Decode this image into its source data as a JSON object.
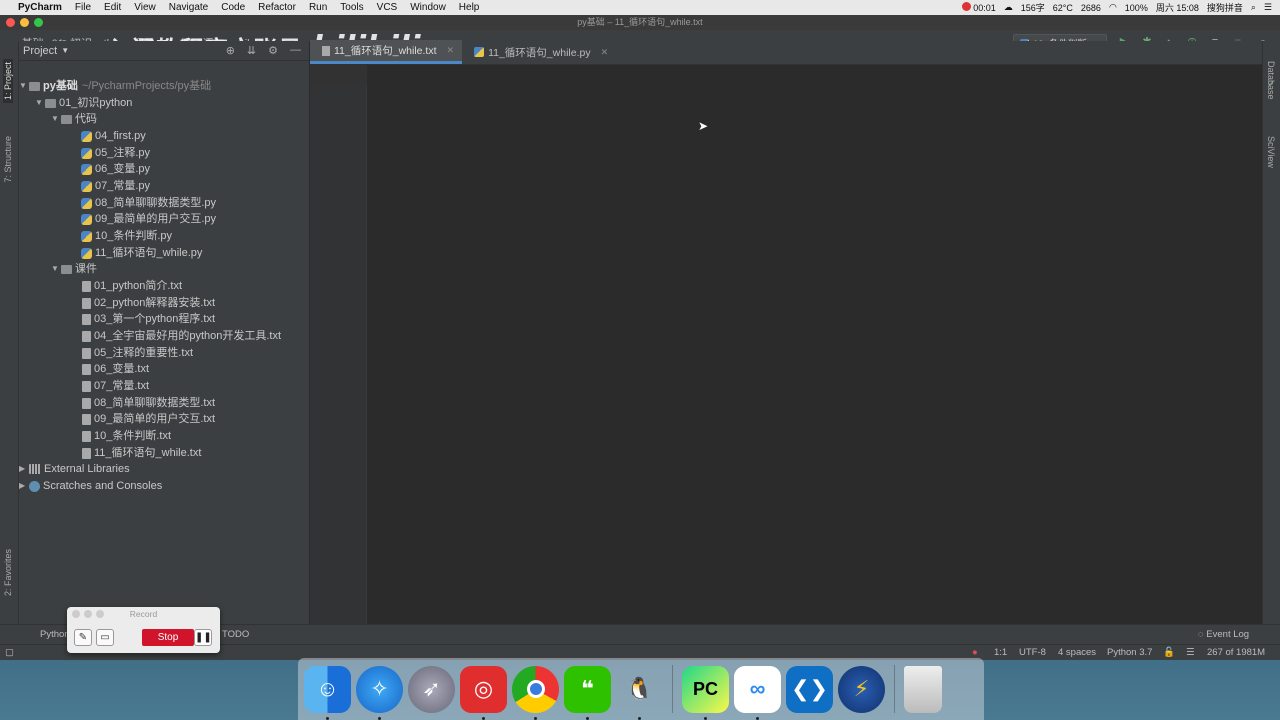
{
  "menubar": {
    "app_name": "PyCharm",
    "items": [
      "File",
      "Edit",
      "View",
      "Navigate",
      "Code",
      "Refactor",
      "Run",
      "Tools",
      "VCS",
      "Window",
      "Help"
    ],
    "recording_time": "00:01",
    "input_count": "156字",
    "temp": "62°C",
    "fan": "2686",
    "battery": "100%",
    "date_time": "周六 15:08",
    "input_method": "搜狗拼音"
  },
  "window": {
    "title": "py基础 – 11_循环语句_while.txt"
  },
  "navbar": {
    "crumbs": [
      "py基础",
      "01_初识python",
      "课件",
      "11_循环语句_while.txt"
    ],
    "run_config": "10_条件判断"
  },
  "watermark": {
    "text": "Python入门教程官方账号",
    "logo": "bilibili"
  },
  "left_strip": {
    "project_tab": "1: Project",
    "structure_tab": "7: Structure",
    "favorites_tab": "2: Favorites"
  },
  "right_strip": {
    "database_tab": "Database",
    "sciview_tab": "SciView"
  },
  "project_panel": {
    "header": "Project",
    "root_name": "py基础",
    "root_path": "~/PycharmProjects/py基础",
    "folder_1": "01_初识python",
    "sub_code": "代码",
    "code_files": [
      "04_first.py",
      "05_注释.py",
      "06_变量.py",
      "07_常量.py",
      "08_简单聊聊数据类型.py",
      "09_最简单的用户交互.py",
      "10_条件判断.py",
      "11_循环语句_while.py"
    ],
    "sub_course": "课件",
    "course_files": [
      "01_python简介.txt",
      "02_python解释器安装.txt",
      "03_第一个python程序.txt",
      "04_全宇宙最好用的python开发工具.txt",
      "05_注释的重要性.txt",
      "06_变量.txt",
      "07_常量.txt",
      "08_简单聊聊数据类型.txt",
      "09_最简单的用户交互.txt",
      "10_条件判断.txt",
      "11_循环语句_while.txt"
    ],
    "external_libraries": "External Libraries",
    "scratches": "Scratches and Consoles"
  },
  "editor": {
    "tabs": [
      {
        "label": "11_循环语句_while.txt",
        "active": true
      },
      {
        "label": "11_循环语句_while.py",
        "active": false
      }
    ]
  },
  "bottom_tools": {
    "python_console": "Python",
    "todo": "TODO",
    "event_log": "Event Log"
  },
  "statusbar": {
    "position": "1:1",
    "encoding": "UTF-8",
    "indent": "4 spaces",
    "interpreter": "Python 3.7",
    "memory": "267 of 1981M"
  },
  "record_widget": {
    "title": "Record",
    "stop_label": "Stop"
  },
  "dock": {
    "apps": [
      "finder-icon",
      "safari-icon",
      "launchpad-icon",
      "netease-music-icon",
      "chrome-icon",
      "wechat-icon",
      "qq-icon",
      "pycharm-icon",
      "baidu-netdisk-icon",
      "vscode-icon",
      "xcode-lightning-icon",
      "trash-icon"
    ]
  }
}
